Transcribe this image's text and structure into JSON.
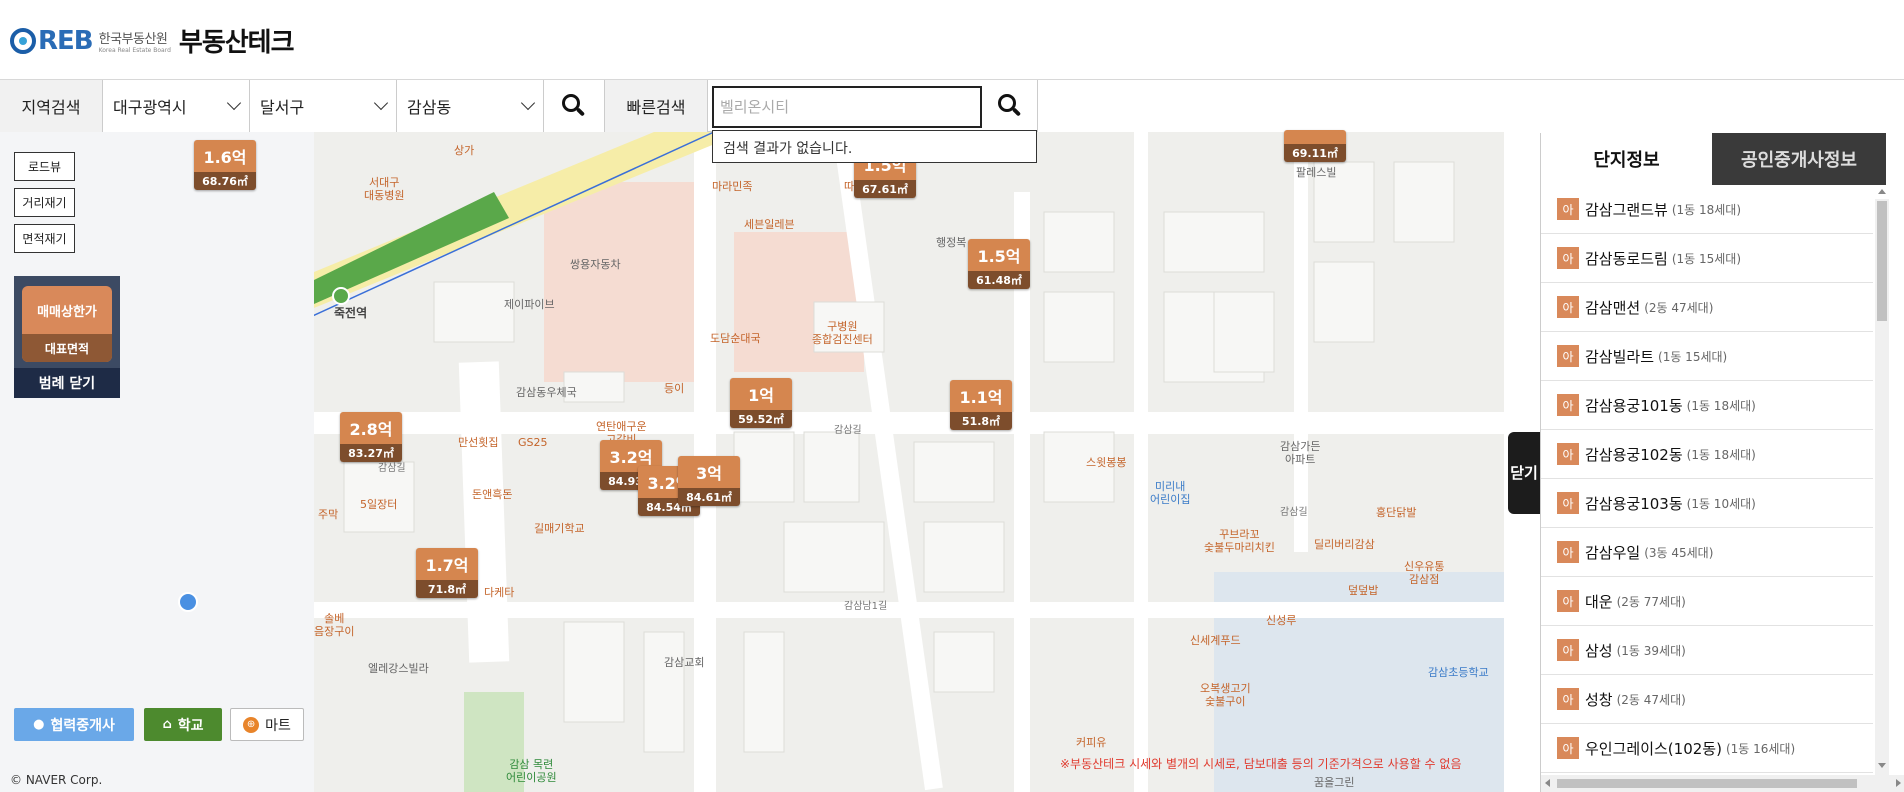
{
  "header": {
    "logo_reb": "REB",
    "logo_ko": "한국부동산원",
    "logo_en": "Korea Real Estate Board",
    "brand_title": "부동산테크"
  },
  "search": {
    "region_label": "지역검색",
    "city": "대구광역시",
    "district": "달서구",
    "dong": "감삼동",
    "quick_label": "빠른검색",
    "quick_placeholder": "벨리온시티",
    "no_result": "검색 결과가 없습니다."
  },
  "tools": {
    "roadview": "로드뷰",
    "distance": "거리재기",
    "area": "면적재기"
  },
  "legend": {
    "price_type": "매매상한가",
    "area_type": "대표면적",
    "close": "범례 닫기"
  },
  "poi_buttons": {
    "agent": "협력중개사",
    "school": "학교",
    "mart": "마트"
  },
  "map": {
    "copyright": "© NAVER Corp.",
    "disclaimer": "※부동산테크 시세와 별개의 시세로, 담보대출 등의 기준가격으로 사용할 수 없음",
    "markers": [
      {
        "price": "1.6억",
        "area": "68.76㎡"
      },
      {
        "price": "1.5억",
        "area": "67.61㎡"
      },
      {
        "price": "1.5억",
        "area": "61.48㎡"
      },
      {
        "price": "1억",
        "area": "59.52㎡"
      },
      {
        "price": "1.1억",
        "area": "51.8㎡"
      },
      {
        "price": "2.8억",
        "area": "83.27㎡"
      },
      {
        "price": "3.2억",
        "area": "84.93㎡"
      },
      {
        "price": "3.2억",
        "area": "84.54㎡"
      },
      {
        "price": "3억",
        "area": "84.61㎡"
      },
      {
        "price": "1.7억",
        "area": "71.8㎡"
      },
      {
        "price": "",
        "area": "69.11㎡"
      }
    ],
    "labels": {
      "l1": "서대구\n대동병원",
      "l2": "마라민족",
      "l3": "세븐일레븐",
      "l4": "따카닭",
      "l5": "쌍용자동차",
      "l6": "제이파이브",
      "l7": "죽전역",
      "l8": "구병원\n종합검진센터",
      "l9": "도담순대국",
      "l10": "감삼동우체국",
      "l11": "등이",
      "l12": "연탄애구운\n고갈비",
      "l13": "만선횟집",
      "l14": "GS25",
      "l15": "돈앤흑돈",
      "l16": "5일장터",
      "l17": "주막",
      "l18": "길매기학교",
      "l19": "다케타",
      "l20": "솔베\n음장구이",
      "l21": "엘레강스빌라",
      "l22": "감삼교회",
      "l23": "감삼 목련\n어린이공원",
      "l24": "행정복",
      "l25": "스윗봉봉",
      "l26": "미리내\n어린이집",
      "l27": "꾸브라꼬\n숯불두마리치킨",
      "l28": "딜리버리감삼",
      "l29": "감삼가든\n아파트",
      "l30": "홍단닭발",
      "l31": "신우유통\n감삼점",
      "l32": "덮덮밥",
      "l33": "신세계푸드",
      "l34": "신성루",
      "l35": "오복생고기\n숯불구이",
      "l36": "감삼초등학교",
      "l37": "커피유",
      "l38": "팔레스빌",
      "l39": "상가",
      "l40": "감삼길",
      "l41": "감삼남1길",
      "l42": "감삼길",
      "l43": "꿈을그린",
      "l44": "감삼길"
    }
  },
  "panel": {
    "tab_complex": "단지정보",
    "tab_agent": "공인중개사정보",
    "close": "닫기",
    "badge": "아",
    "complexes": [
      {
        "name": "감삼그랜드뷰",
        "meta": "(1동 18세대)"
      },
      {
        "name": "감삼동로드림",
        "meta": "(1동 15세대)"
      },
      {
        "name": "감삼맨션",
        "meta": "(2동 47세대)"
      },
      {
        "name": "감삼빌라트",
        "meta": "(1동 15세대)"
      },
      {
        "name": "감삼용궁101동",
        "meta": "(1동 18세대)"
      },
      {
        "name": "감삼용궁102동",
        "meta": "(1동 18세대)"
      },
      {
        "name": "감삼용궁103동",
        "meta": "(1동 10세대)"
      },
      {
        "name": "감삼우일",
        "meta": "(3동 45세대)"
      },
      {
        "name": "대운",
        "meta": "(2동 77세대)"
      },
      {
        "name": "삼성",
        "meta": "(1동 39세대)"
      },
      {
        "name": "성창",
        "meta": "(2동 47세대)"
      },
      {
        "name": "우인그레이스(102동)",
        "meta": "(1동 16세대)"
      }
    ]
  },
  "colors": {
    "marker_price": "#d5864f",
    "marker_area": "#7d4d2c",
    "legend_bg": "#3c4a63",
    "agent_btn": "#6aa8e8",
    "school_btn": "#4d8a2e",
    "subway_green": "#5aa84a"
  }
}
